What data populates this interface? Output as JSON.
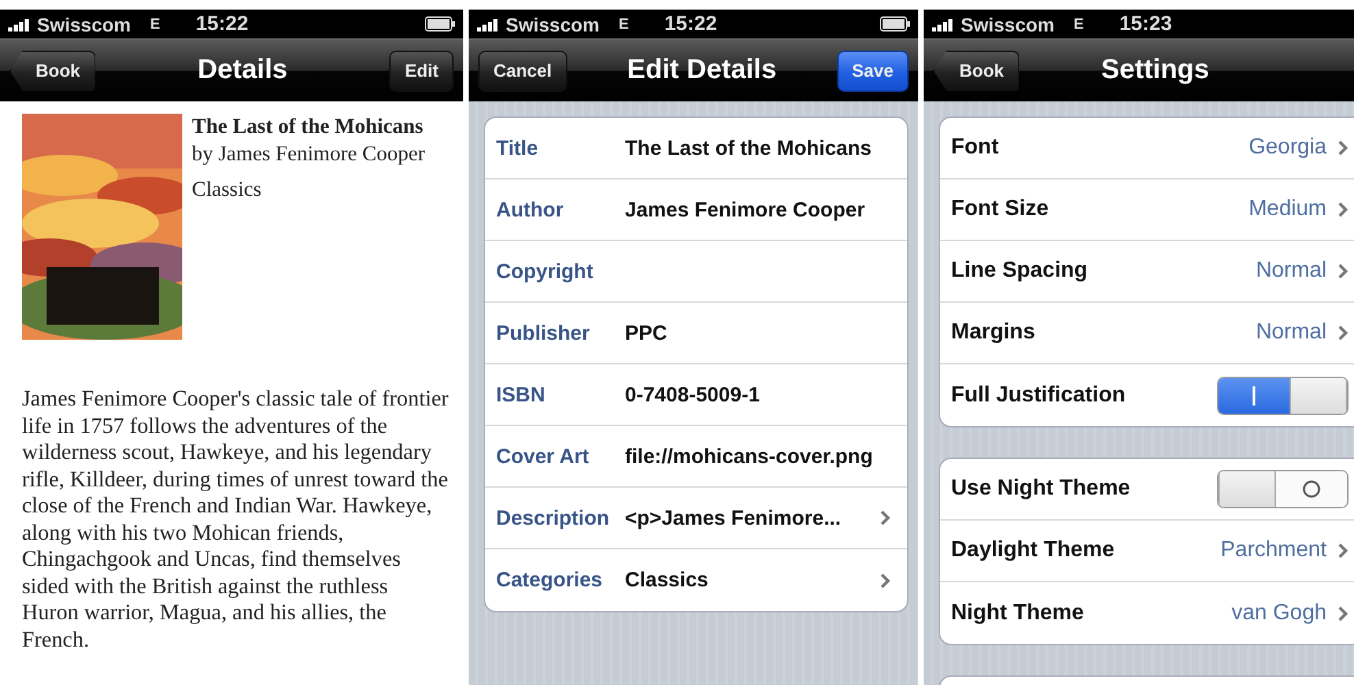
{
  "details_screen": {
    "status_bar": {
      "carrier": "Swisscom",
      "network": "E",
      "time": "15:22"
    },
    "nav_bar": {
      "back": "Book",
      "title": "Details",
      "action": "Edit"
    },
    "book": {
      "title": "The Last of the Mohicans",
      "byline": "by James Fenimore Cooper",
      "category": "Classics"
    },
    "description": "James Fenimore Cooper's classic tale of frontier life in 1757 follows the adventures of the wilderness scout, Hawkeye, and his legendary rifle, Killdeer, during times of unrest toward the close of the French and Indian War. Hawkeye, along with his two Mohican friends, Chingachgook and Uncas, find themselves sided with the British against the ruthless Huron warrior, Magua, and his allies, the French."
  },
  "edit_screen": {
    "status_bar": {
      "carrier": "Swisscom",
      "network": "E",
      "time": "15:22"
    },
    "nav_bar": {
      "cancel": "Cancel",
      "title": "Edit Details",
      "save": "Save"
    },
    "fields": [
      {
        "label": "Title",
        "value": "The Last of the Mohicans",
        "disclosure": false
      },
      {
        "label": "Author",
        "value": "James Fenimore Cooper",
        "disclosure": false
      },
      {
        "label": "Copyright",
        "disclosure": false
      },
      {
        "label": "Publisher",
        "value": "PPC",
        "disclosure": false
      },
      {
        "label": "ISBN",
        "value": "0-7408-5009-1",
        "disclosure": false
      },
      {
        "label": "Cover Art",
        "value": "file://mohicans-cover.png",
        "disclosure": false
      },
      {
        "label": "Description",
        "value": "<p>James Fenimore...",
        "disclosure": true
      },
      {
        "label": "Categories",
        "value": "Classics",
        "disclosure": true
      }
    ]
  },
  "settings_screen": {
    "status_bar": {
      "carrier": "Swisscom",
      "network": "E",
      "time": "15:23"
    },
    "nav_bar": {
      "back": "Book",
      "title": "Settings"
    },
    "sections": [
      {
        "kind": "full",
        "rows": [
          {
            "kind": "choice",
            "label": "Font",
            "value": "Georgia"
          },
          {
            "kind": "choice",
            "label": "Font Size",
            "value": "Medium"
          },
          {
            "kind": "choice",
            "label": "Line Spacing",
            "value": "Normal"
          },
          {
            "kind": "choice",
            "label": "Margins",
            "value": "Normal"
          },
          {
            "kind": "switch",
            "label": "Full Justification",
            "on": true
          }
        ]
      },
      {
        "kind": "full",
        "rows": [
          {
            "kind": "switch",
            "label": "Use Night Theme",
            "on": false
          },
          {
            "kind": "choice",
            "label": "Daylight Theme",
            "value": "Parchment"
          },
          {
            "kind": "choice",
            "label": "Night Theme",
            "value": "van Gogh"
          }
        ]
      },
      {
        "kind": "cut_off"
      }
    ]
  }
}
